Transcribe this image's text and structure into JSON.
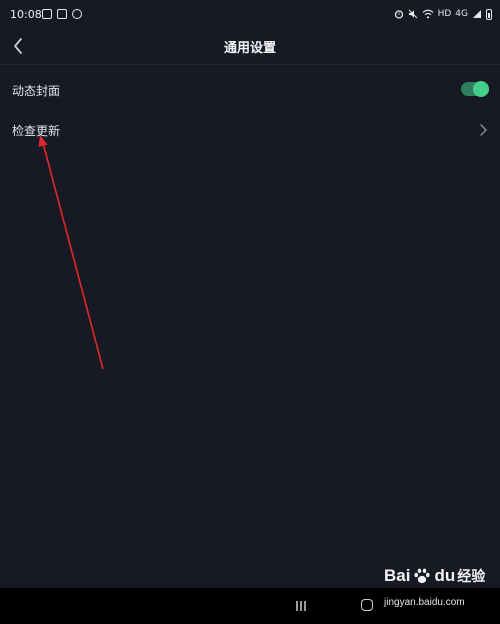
{
  "status_bar": {
    "time": "10:08",
    "left_icons": [
      "image-icon",
      "sim-icon",
      "chat-bubble-icon"
    ],
    "right_icons": [
      "alarm-icon",
      "mute-icon",
      "wifi-icon",
      "hd-icon",
      "signal-icon",
      "battery-icon"
    ],
    "hd_label": "HD",
    "network_label": "4G"
  },
  "header": {
    "back_icon": "chevron-left-icon",
    "title": "通用设置"
  },
  "settings": [
    {
      "label": "动态封面",
      "control": "toggle",
      "on": true
    },
    {
      "label": "检查更新",
      "control": "chevron"
    }
  ],
  "colors": {
    "background": "#171a24",
    "toggle_track": "#2f7e5c",
    "toggle_knob": "#44d08b",
    "annotation_arrow": "#e0282a"
  },
  "nav_bar": {
    "recent_icon": "recent-apps-icon",
    "home_icon": "home-icon"
  },
  "watermark": {
    "brand": "Bai",
    "paw_icon": "paw-icon",
    "du": "du",
    "jingyan": "经验",
    "url": "jingyan.baidu.com"
  }
}
